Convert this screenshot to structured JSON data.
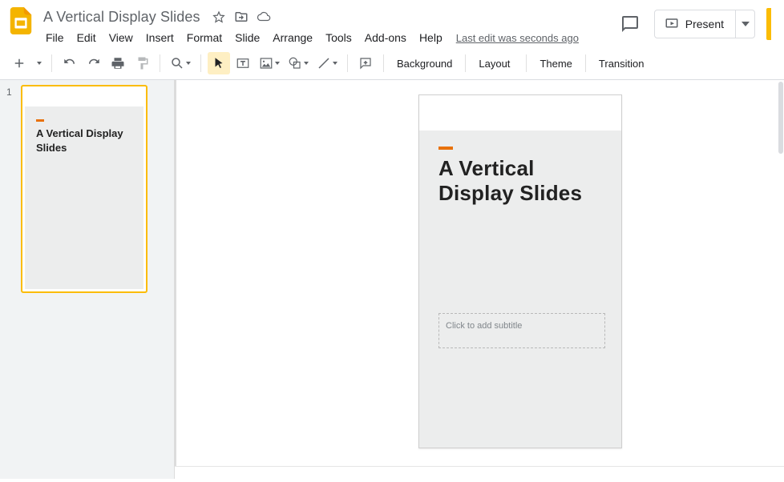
{
  "doc": {
    "title": "A Vertical Display Slides"
  },
  "menus": [
    "File",
    "Edit",
    "View",
    "Insert",
    "Format",
    "Slide",
    "Arrange",
    "Tools",
    "Add-ons",
    "Help"
  ],
  "last_edit": "Last edit was seconds ago",
  "present": {
    "label": "Present"
  },
  "toolbar": {
    "background": "Background",
    "layout": "Layout",
    "theme": "Theme",
    "transition": "Transition"
  },
  "filmstrip": {
    "slides": [
      {
        "num": "1",
        "title": "A Vertical Display Slides"
      }
    ]
  },
  "slide": {
    "title": "A Vertical Display Slides",
    "subtitle_placeholder": "Click to add subtitle"
  }
}
